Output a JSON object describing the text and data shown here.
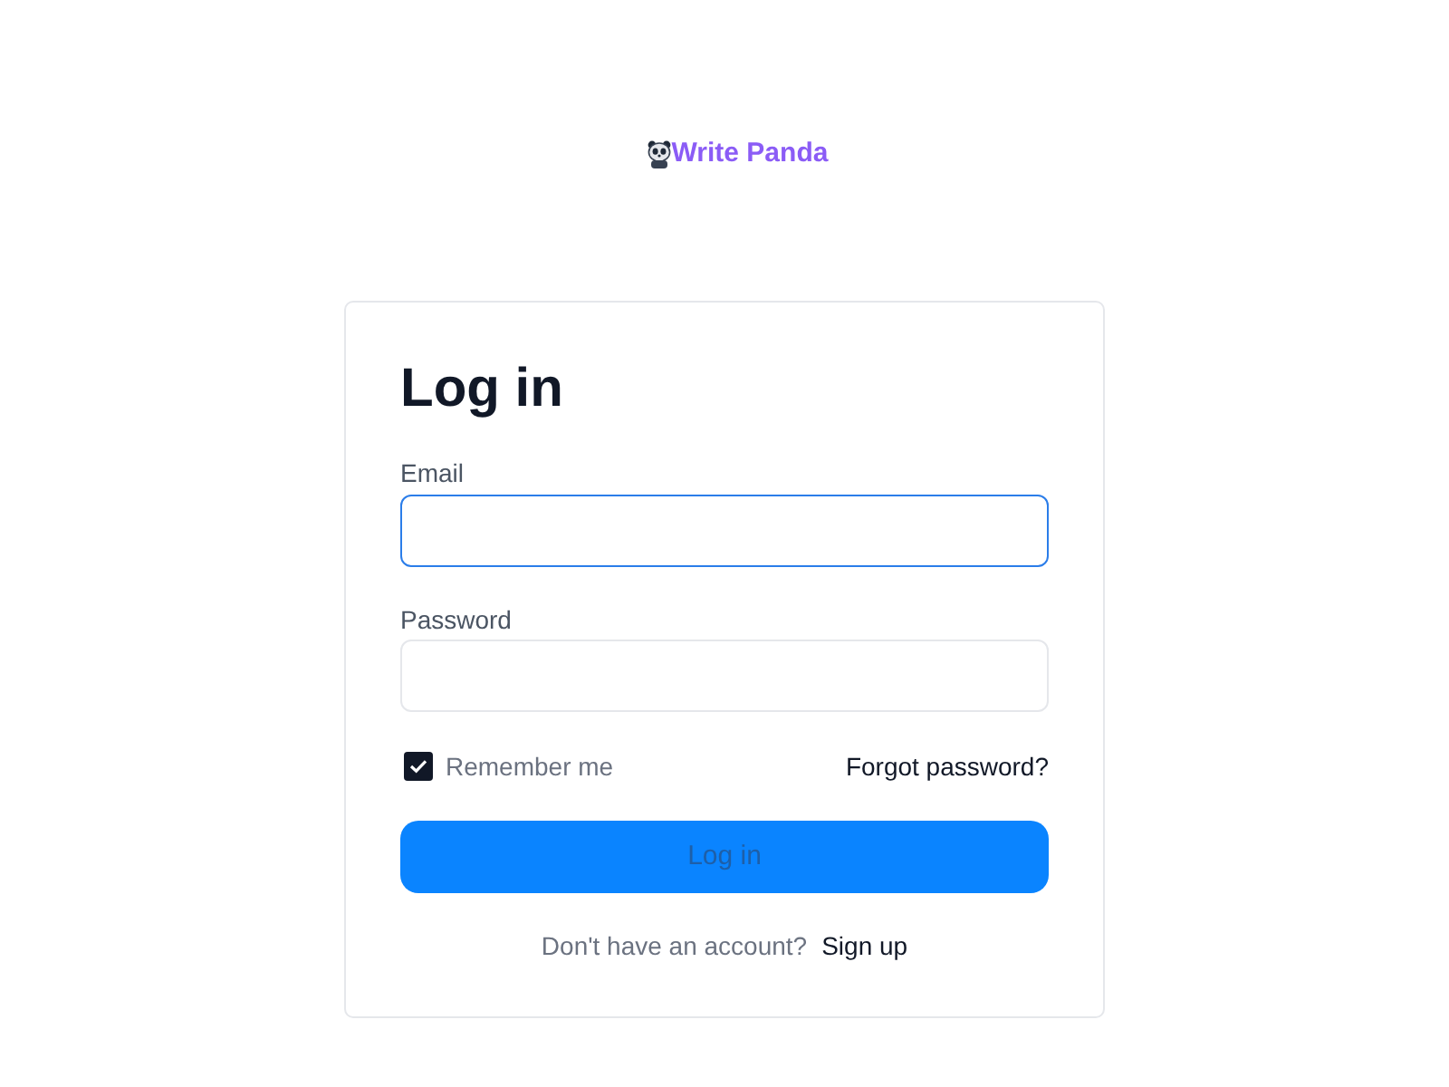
{
  "logo": {
    "text": "Write Panda"
  },
  "login_form": {
    "title": "Log in",
    "fields": [
      {
        "label": "Email",
        "focused": true
      },
      {
        "label": "Password",
        "focused": false
      }
    ],
    "remember_me": {
      "label": "Remember me",
      "checked": true
    },
    "forgot_password_link": "Forgot password?",
    "submit_button": "Log in",
    "signup_prompt": {
      "text": "Don't have an account?",
      "link": "Sign up"
    }
  }
}
